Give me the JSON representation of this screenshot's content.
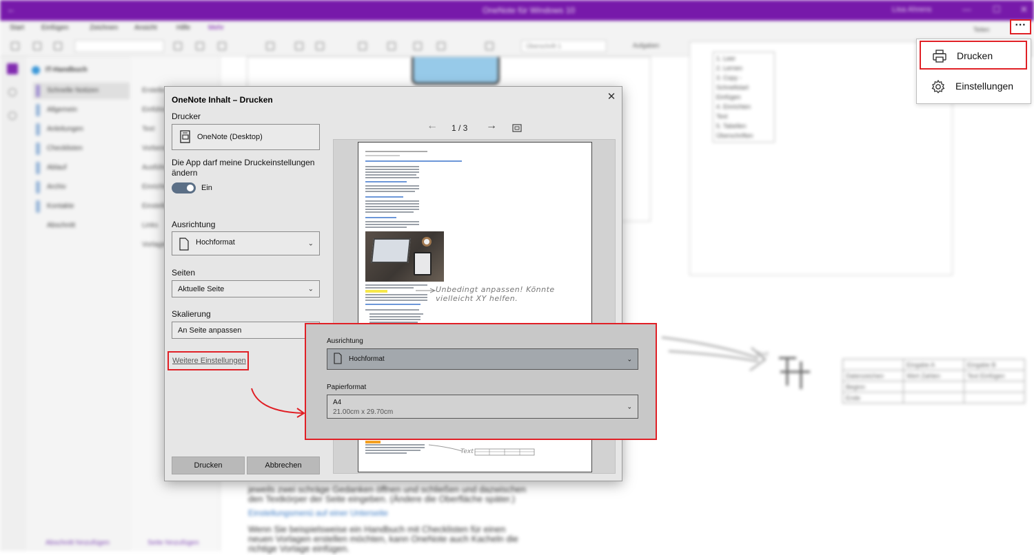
{
  "background": {
    "window_title": "OneNote für Windows 10",
    "user_name": "Lisa Ahrens",
    "ribbon_tabs": [
      "Start",
      "Einfügen",
      "Zeichnen",
      "Ansicht",
      "Hilfe",
      "Mehr"
    ],
    "toolbar_style_box": "Überschrift 1",
    "toolbar_share": "Teilen",
    "toolbar_bold_tag": "Aufgaben",
    "notebook_name": "IT-Handbuch",
    "sections": [
      "Schnelle Notizen",
      "Allgemein",
      "Anleitungen",
      "Checklisten",
      "Ablauf",
      "Archiv",
      "Kontakte",
      "Abschnitt"
    ],
    "pages": [
      "Erstellen",
      "Einführung",
      "Text",
      "Vorbereitung",
      "Ausführung",
      "Einrichtung",
      "Einstellungen",
      "Links",
      "Vorlagen"
    ],
    "add_section": "Abschnitt hinzufügen",
    "add_page": "Seite hinzufügen",
    "list_box_items": [
      "1. Leer",
      "2. Lernen",
      "3. Copy - Schnellstart",
      "Einfügen",
      "4. Einrichten",
      "Text",
      "5. Tabellen",
      "Überschriften"
    ],
    "body_text_1": "jeweils zwei schräge Gedanken öffnen und schließen und dazwischen",
    "body_text_2": "den Textkörper der Seite eingeben. (Ändere die Oberfläche später.)",
    "body_link": "Einstellungsmenü auf einer Unterseite",
    "body_text_3": "Wenn Sie beispielsweise ein Handbuch mit Checklisten für einen",
    "body_text_4": "neuen Vorlagen erstellen möchten, kann OneNote auch Kacheln die",
    "body_text_5": "richtige Vorlage einfügen.",
    "sketch_label": "Text",
    "sketch_table_header": [
      "",
      "Eingabe A",
      "Eingabe B"
    ],
    "sketch_table_rows": [
      [
        "Datenzeichen",
        "Wert Zahlen",
        "Text Einfügen"
      ],
      [
        "Beginn",
        "",
        ""
      ],
      [
        "Ende",
        "",
        ""
      ]
    ]
  },
  "dialog": {
    "title": "OneNote Inhalt – Drucken",
    "close_symbol": "✕",
    "printer_label": "Drucker",
    "printer_value": "OneNote (Desktop)",
    "allow_settings_label": "Die App darf meine Druckeinstellungen ändern",
    "toggle_state": "Ein",
    "orientation_label": "Ausrichtung",
    "orientation_value": "Hochformat",
    "pages_label": "Seiten",
    "pages_value": "Aktuelle Seite",
    "scaling_label": "Skalierung",
    "scaling_value": "An Seite anpassen",
    "more_settings_link": "Weitere Einstellungen",
    "print_button": "Drucken",
    "cancel_button": "Abbrechen",
    "page_indicator": "1 / 3",
    "preview_note": "Unbedingt anpassen! Könnte vielleicht XY helfen.",
    "preview_bottom_text": "Text"
  },
  "callout": {
    "orientation_label": "Ausrichtung",
    "orientation_value": "Hochformat",
    "paper_label": "Papierformat",
    "paper_value": "A4",
    "paper_size": "21.00cm x 29.70cm"
  },
  "more_menu": {
    "button_symbol": "···",
    "items": [
      {
        "label": "Drucken",
        "icon": "printer-icon"
      },
      {
        "label": "Einstellungen",
        "icon": "gear-icon"
      }
    ]
  },
  "colors": {
    "accent_purple": "#7719aa",
    "highlight_red": "#e01f25"
  }
}
